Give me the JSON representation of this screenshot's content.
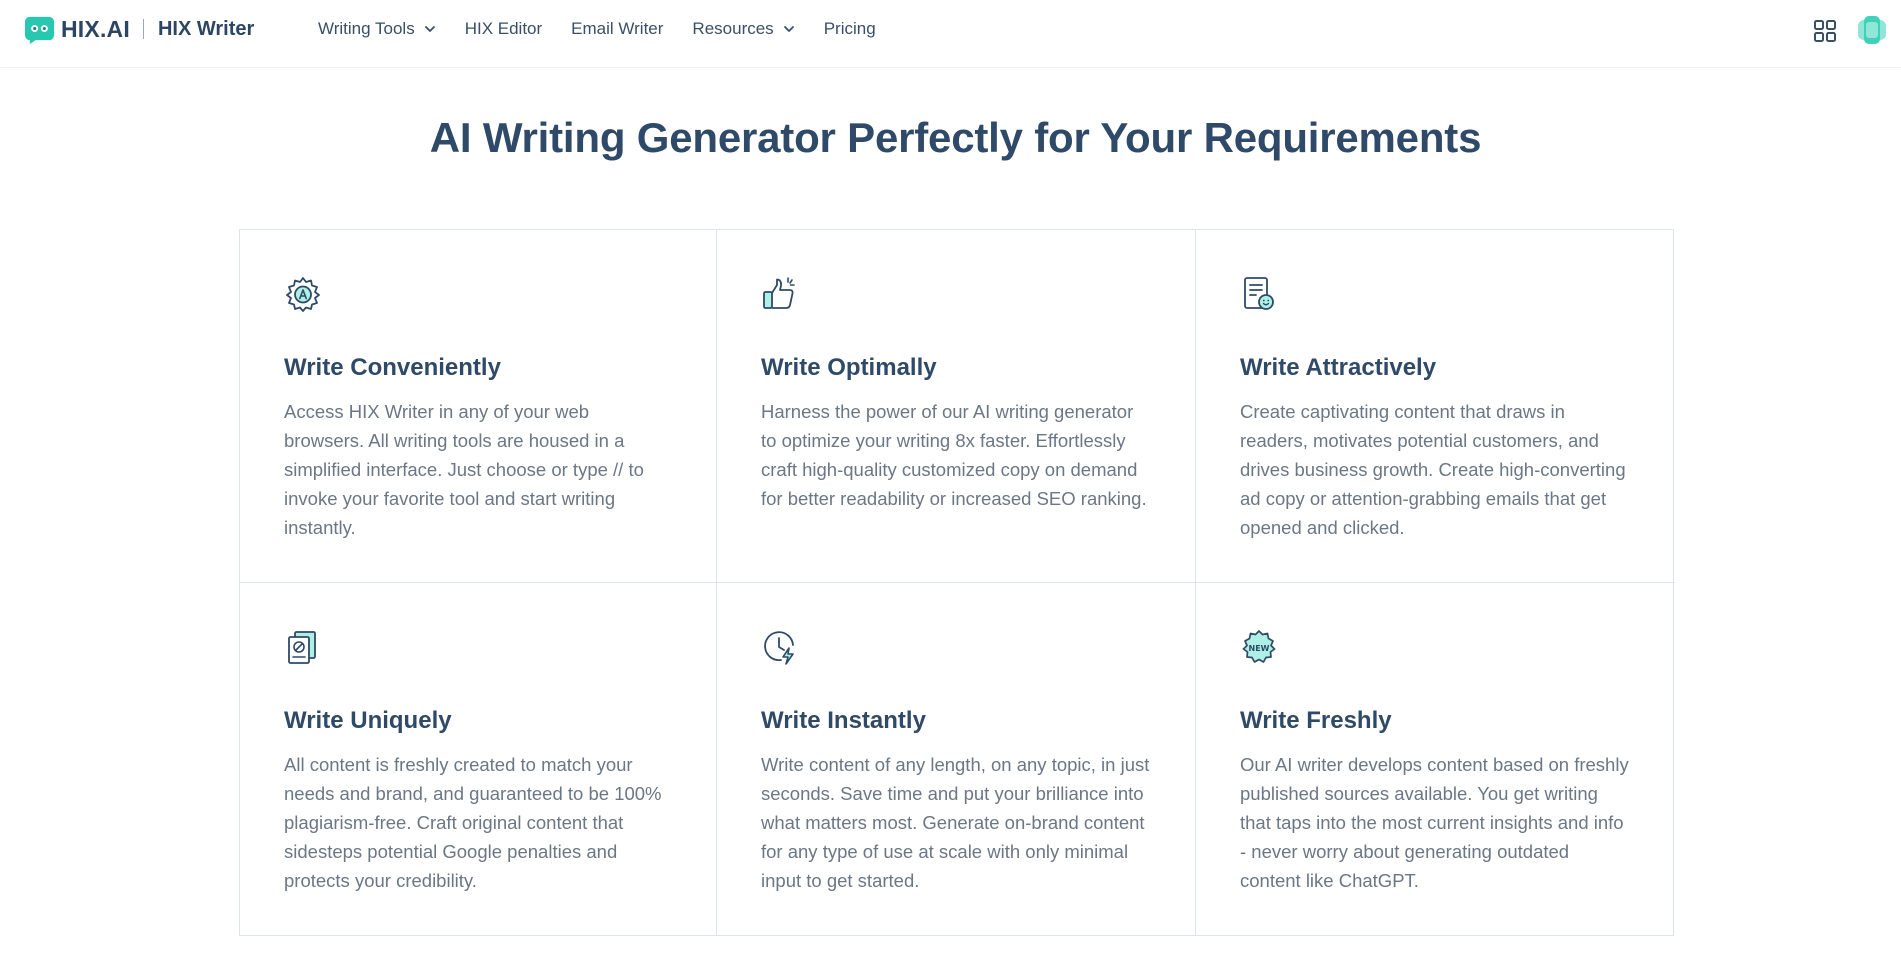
{
  "header": {
    "brand": "HIX.AI",
    "product": "HIX Writer",
    "nav": [
      {
        "label": "Writing Tools",
        "has_dropdown": true
      },
      {
        "label": "HIX Editor",
        "has_dropdown": false
      },
      {
        "label": "Email Writer",
        "has_dropdown": false
      },
      {
        "label": "Resources",
        "has_dropdown": true
      },
      {
        "label": "Pricing",
        "has_dropdown": false
      }
    ],
    "icons": [
      "apps-grid-icon",
      "avatar"
    ]
  },
  "main": {
    "title": "AI Writing Generator Perfectly for Your Requirements",
    "features": [
      {
        "icon": "gear-ai-icon",
        "title": "Write Conveniently",
        "description": "Access HIX Writer in any of your web browsers. All writing tools are housed in a simplified interface. Just choose or type // to invoke your favorite tool and start writing instantly."
      },
      {
        "icon": "thumbs-up-icon",
        "title": "Write Optimally",
        "description": "Harness the power of our AI writing generator to optimize your writing 8x faster. Effortlessly craft high-quality customized copy on demand for better readability or increased SEO ranking."
      },
      {
        "icon": "document-smile-icon",
        "title": "Write Attractively",
        "description": "Create captivating content that draws in readers, motivates potential customers, and drives business growth. Create high-converting ad copy or attention-grabbing emails that get opened and clicked."
      },
      {
        "icon": "unique-document-icon",
        "title": "Write Uniquely",
        "description": "All content is freshly created to match your needs and brand, and guaranteed to be 100% plagiarism-free. Craft original content that sidesteps potential Google penalties and protects your credibility."
      },
      {
        "icon": "clock-lightning-icon",
        "title": "Write Instantly",
        "description": "Write content of any length, on any topic, in just seconds. Save time and put your brilliance into what matters most. Generate on-brand content for any type of use at scale with only minimal input to get started."
      },
      {
        "icon": "new-badge-icon",
        "title": "Write Freshly",
        "description": "Our AI writer develops content based on freshly published sources available. You get writing that taps into the most current insights and info - never worry about generating outdated content like ChatGPT."
      }
    ]
  },
  "colors": {
    "brand_teal": "#27c7b2",
    "heading": "#2f4a68",
    "body_text": "#6b7785",
    "border": "#dde4ec"
  }
}
